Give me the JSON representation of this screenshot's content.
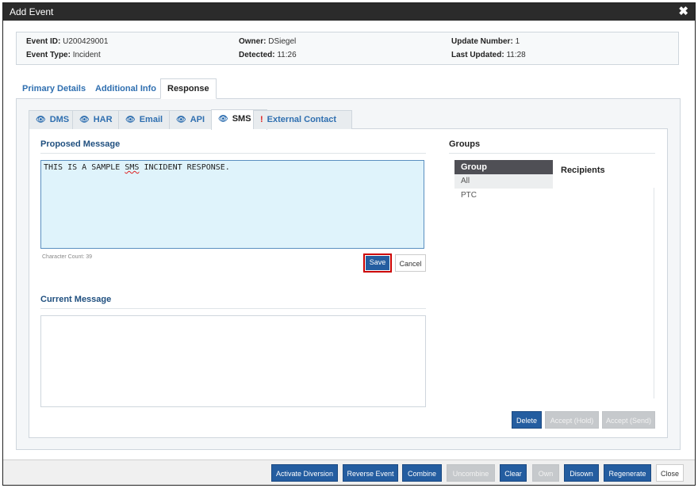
{
  "dialog": {
    "title": "Add Event",
    "close_glyph": "✖"
  },
  "info": {
    "event_id_label": "Event ID:",
    "event_id_value": "U200429001",
    "event_type_label": "Event Type:",
    "event_type_value": "Incident",
    "owner_label": "Owner:",
    "owner_value": "DSiegel",
    "detected_label": "Detected:",
    "detected_value": "11:26",
    "update_number_label": "Update Number:",
    "update_number_value": "1",
    "last_updated_label": "Last Updated:",
    "last_updated_value": "11:28"
  },
  "main_tabs": [
    {
      "label": "Primary Details",
      "active": false
    },
    {
      "label": "Additional Info",
      "active": false
    },
    {
      "label": "Response",
      "active": true
    }
  ],
  "response_tabs": [
    {
      "label": "DMS",
      "icon": "eye-icon",
      "active": false
    },
    {
      "label": "HAR",
      "icon": "eye-icon",
      "active": false
    },
    {
      "label": "Email",
      "icon": "eye-icon",
      "active": false
    },
    {
      "label": "API",
      "icon": "eye-icon",
      "active": false
    },
    {
      "label": "SMS",
      "icon": "eye-icon",
      "active": true
    },
    {
      "label": "External Contact",
      "icon": "exclamation-icon",
      "active": false
    }
  ],
  "proposed": {
    "title": "Proposed Message",
    "text_before": "THIS IS A SAMPLE ",
    "text_misspelled": "SMS",
    "text_after": " INCIDENT RESPONSE.",
    "char_count": "Character Count: 39",
    "save_label": "Save",
    "cancel_label": "Cancel"
  },
  "current": {
    "title": "Current Message"
  },
  "groups": {
    "title": "Groups",
    "header": "Group",
    "items": [
      "All",
      "PTC"
    ],
    "recipients_title": "Recipients",
    "delete_label": "Delete",
    "accept_hold_label": "Accept (Hold)",
    "accept_send_label": "Accept (Send)"
  },
  "footer": {
    "activate_diversion": "Activate Diversion",
    "reverse_event": "Reverse Event",
    "combine": "Combine",
    "uncombine": "Uncombine",
    "clear": "Clear",
    "own": "Own",
    "disown": "Disown",
    "regenerate": "Regenerate",
    "close": "Close"
  },
  "colors": {
    "accent": "#245da0",
    "link": "#2f6fb0",
    "titlebar": "#2b2b2b",
    "highlight": "#cc0000"
  }
}
